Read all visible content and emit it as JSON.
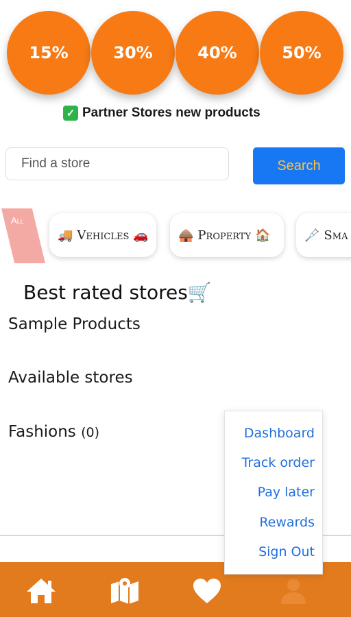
{
  "discounts": [
    "15%",
    "30%",
    "40%",
    "50%"
  ],
  "partner": {
    "check": "✓",
    "text": "Partner Stores new products"
  },
  "search": {
    "placeholder": "Find a store",
    "button": "Search"
  },
  "categories": {
    "all": "All",
    "items": [
      {
        "label": "Vehicles",
        "icon_left": "🚚",
        "icon_right": "🚗"
      },
      {
        "label": "Property",
        "icon_left": "🛖",
        "icon_right": "🏠"
      },
      {
        "label": "Sma",
        "icon_left": "🩼",
        "icon_right": ""
      }
    ]
  },
  "sections": {
    "best_rated": "Best rated stores🛒",
    "sample_products": "Sample Products",
    "available_stores": "Available stores",
    "fashions": "Fashions",
    "fashions_count": "(0)"
  },
  "menu": [
    "Dashboard",
    "Track order",
    "Pay later",
    "Rewards",
    "Sign Out"
  ],
  "bottom_nav": [
    "home-icon",
    "map-icon",
    "heart-icon",
    "user-icon"
  ],
  "colors": {
    "accent": "#f77a14",
    "nav": "#e27b1d",
    "link": "#1f6fe0",
    "button": "#1877f2"
  }
}
